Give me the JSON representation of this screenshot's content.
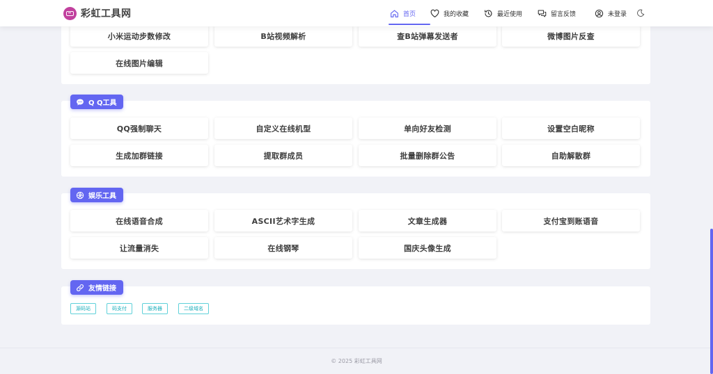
{
  "brand": {
    "name": "彩虹工具网",
    "logo_color": "#c1409e"
  },
  "nav": {
    "items": [
      {
        "label": "首页",
        "icon": "home-icon",
        "active": true
      },
      {
        "label": "我的收藏",
        "icon": "heart-icon"
      },
      {
        "label": "最近使用",
        "icon": "history-icon"
      },
      {
        "label": "留言反馈",
        "icon": "chat-bubbles-icon"
      },
      {
        "label": "未登录",
        "icon": "user-icon"
      }
    ],
    "theme_toggle_icon": "moon-icon",
    "accent": "#6366f1"
  },
  "sections": {
    "top": {
      "tools": [
        "小米运动步数修改",
        "B站视频解析",
        "查B站弹幕发送者",
        "微博图片反查",
        "在线图片编辑"
      ]
    },
    "qq": {
      "title": "Q Q工具",
      "icon": "chat-icon",
      "tools": [
        "QQ强制聊天",
        "自定义在线机型",
        "单向好友检测",
        "设置空白昵称",
        "生成加群链接",
        "提取群成员",
        "批量删除群公告",
        "自助解散群"
      ]
    },
    "entertainment": {
      "title": "娱乐工具",
      "icon": "aperture-icon",
      "tools": [
        "在线语音合成",
        "ASCII艺术字生成",
        "文章生成器",
        "支付宝到账语音",
        "让流量消失",
        "在线钢琴",
        "国庆头像生成"
      ]
    },
    "links": {
      "title": "友情链接",
      "icon": "link-icon",
      "items": [
        "源码站",
        "码支付",
        "服务器",
        "二级域名"
      ],
      "tag_color": "#1aaebb"
    }
  },
  "footer": {
    "text": "© 2025 彩虹工具网"
  }
}
